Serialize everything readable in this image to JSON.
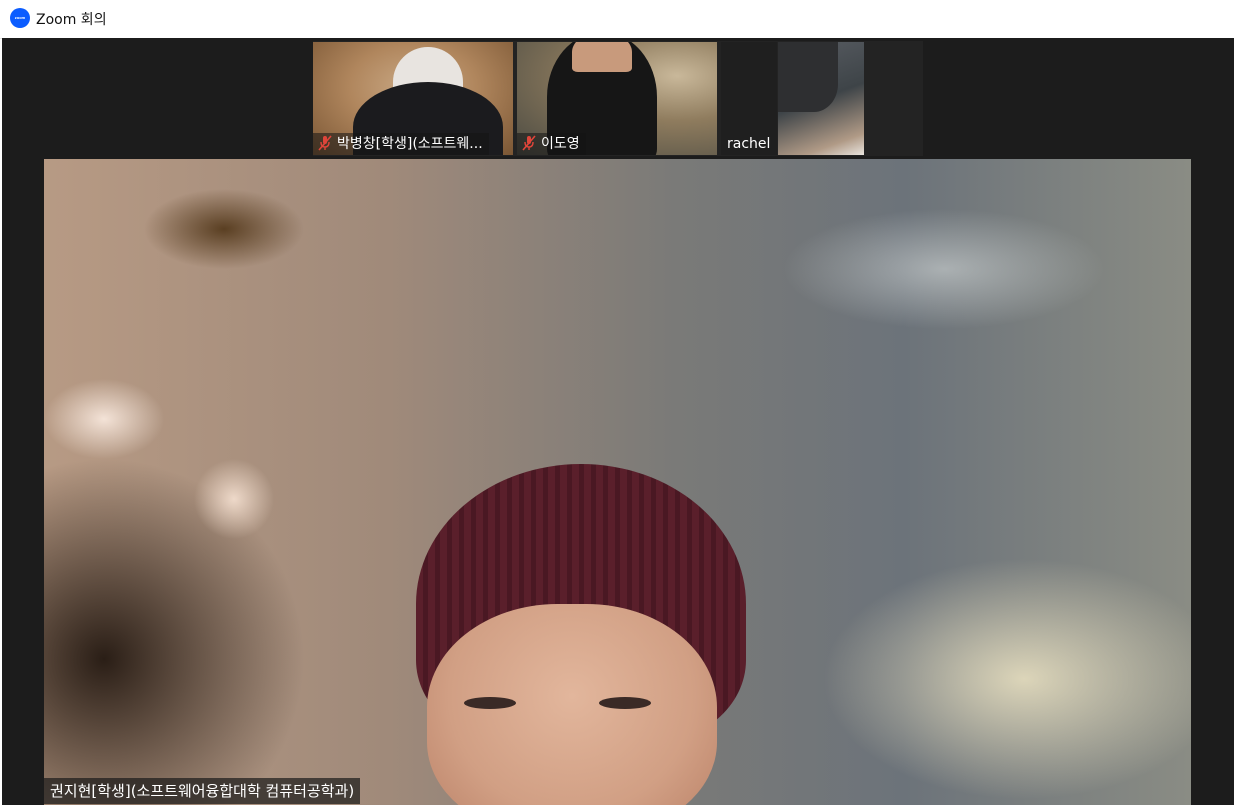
{
  "window": {
    "title": "Zoom 회의",
    "app_icon_text": "zoom"
  },
  "gallery": {
    "tiles": [
      {
        "name": "박병창[학생](소프트웨...",
        "muted": true
      },
      {
        "name": "이도영",
        "muted": true
      },
      {
        "name": "rachel",
        "muted": false
      },
      {
        "name": "",
        "muted": false
      }
    ]
  },
  "speaker": {
    "name": "권지현[학생](소프트웨어융합대학 컴퓨터공학과)"
  },
  "icons": {
    "muted_mic": "mic-muted-icon",
    "app": "zoom-app-icon"
  },
  "colors": {
    "muted_icon": "#e0453a",
    "brand": "#0b5cff",
    "background": "#1c1c1c"
  }
}
